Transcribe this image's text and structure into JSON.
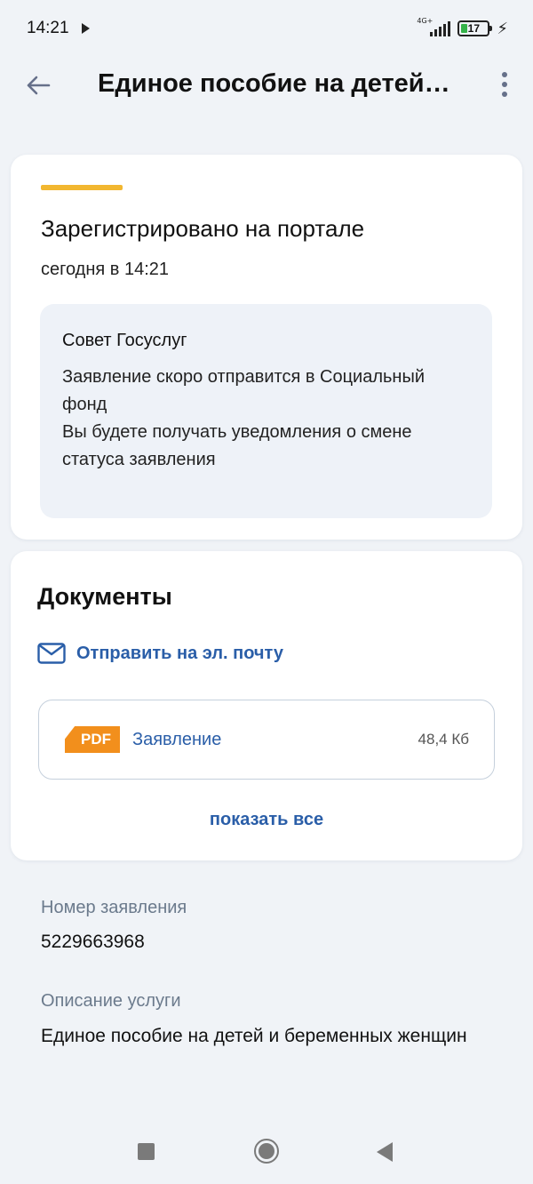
{
  "status_bar": {
    "time": "14:21",
    "network": "4G+",
    "battery": "17"
  },
  "app_bar": {
    "title": "Единое пособие на детей и беременных женщин"
  },
  "status_card": {
    "title": "Зарегистрировано на портале",
    "time": "сегодня в 14:21",
    "tip": {
      "title": "Совет Госуслуг",
      "lines": [
        "Заявление скоро отправится в Социальный",
        "фонд",
        "Вы будете получать уведомления о смене",
        "статуса заявления"
      ]
    }
  },
  "documents": {
    "title": "Документы",
    "email_label": "Отправить на эл. почту",
    "files": [
      {
        "badge": "PDF",
        "name": "Заявление",
        "size": "48,4 Кб"
      }
    ],
    "show_all": "показать все"
  },
  "info": {
    "number_label": "Номер заявления",
    "number_value": "5229663968",
    "service_label": "Описание услуги",
    "service_value": "Единое пособие на детей и беременных женщин"
  },
  "colors": {
    "accent": "#f2b730",
    "link": "#2a5ea8",
    "pdf": "#f28f1c",
    "tip_bg": "#eef2f8",
    "page_bg": "#f0f3f7"
  }
}
